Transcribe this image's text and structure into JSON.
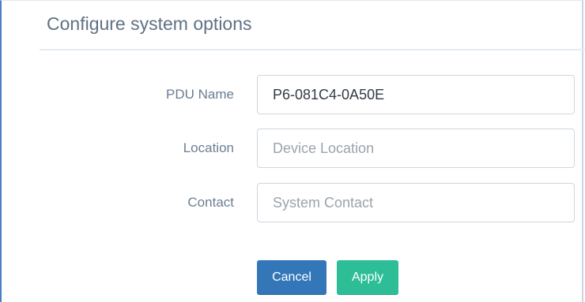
{
  "panel": {
    "title": "Configure system options"
  },
  "form": {
    "pdu_name": {
      "label": "PDU Name",
      "value": "P6-081C4-0A50E",
      "placeholder": ""
    },
    "location": {
      "label": "Location",
      "value": "",
      "placeholder": "Device Location"
    },
    "contact": {
      "label": "Contact",
      "value": "",
      "placeholder": "System Contact"
    }
  },
  "actions": {
    "cancel_label": "Cancel",
    "apply_label": "Apply"
  },
  "colors": {
    "cancel_button": "#3477b9",
    "apply_button": "#2dbe98",
    "title_text": "#5f7184",
    "frame_accent": "#4a7fc1"
  }
}
